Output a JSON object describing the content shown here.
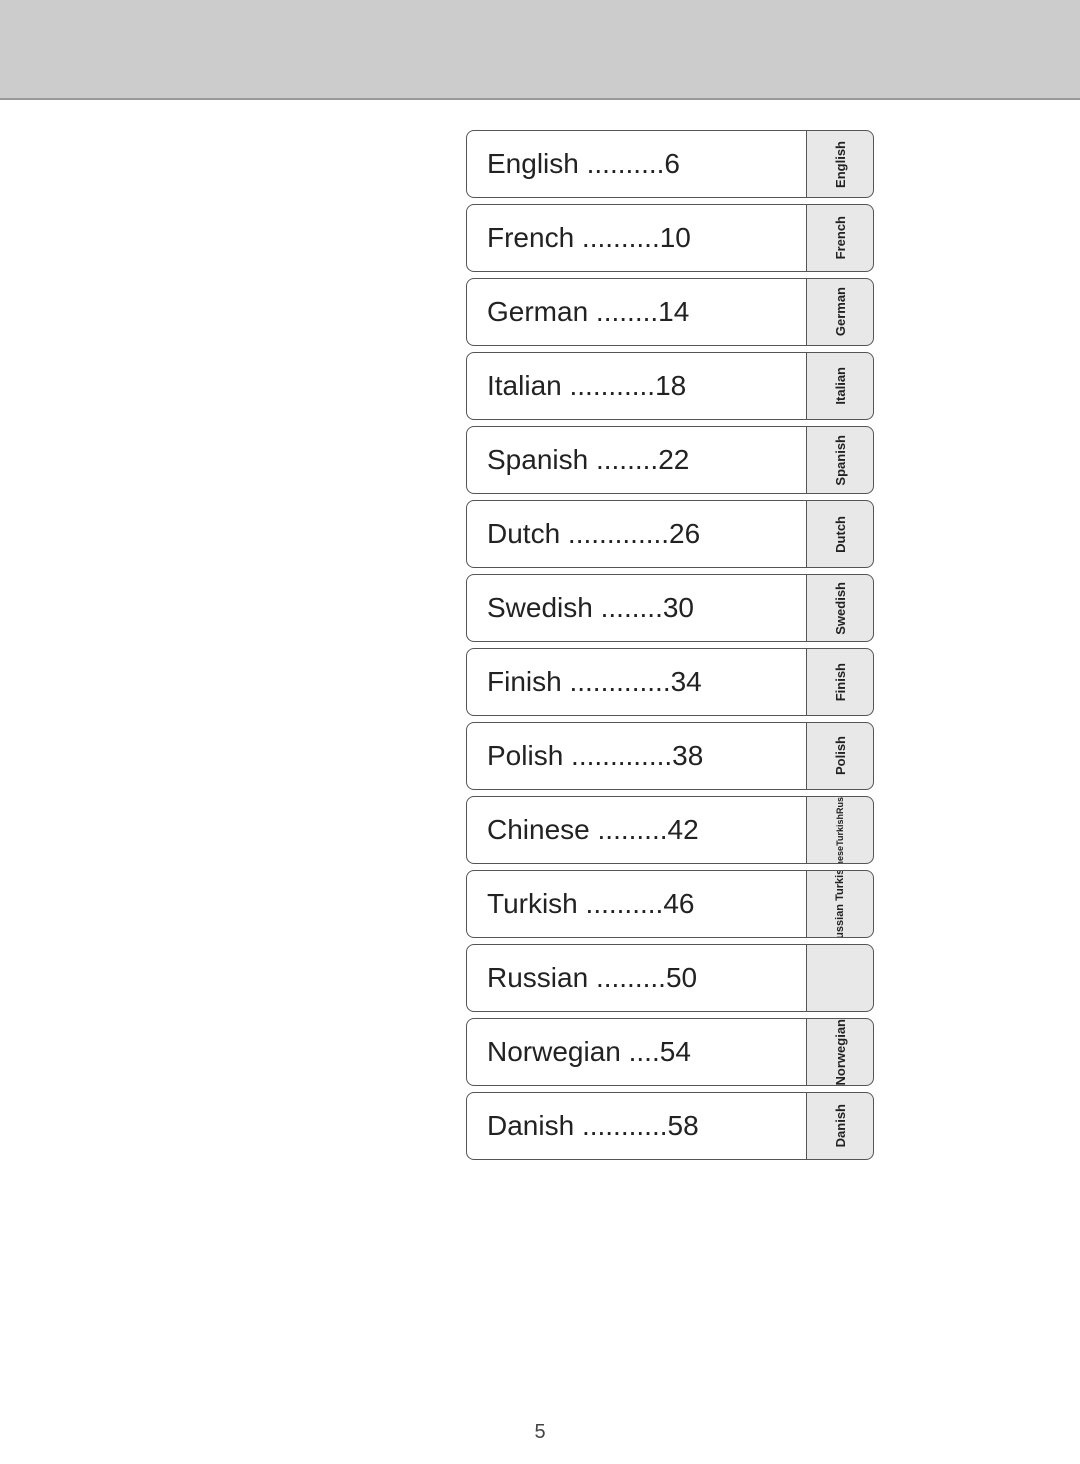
{
  "header": {
    "background": "#cccccc"
  },
  "page_number": "5",
  "toc": {
    "items": [
      {
        "label": "English ..........6",
        "tab": "English",
        "multi": false
      },
      {
        "label": "French ..........10",
        "tab": "French",
        "multi": false
      },
      {
        "label": "German ........14",
        "tab": "German",
        "multi": false
      },
      {
        "label": "Italian ...........18",
        "tab": "Italian",
        "multi": false
      },
      {
        "label": "Spanish ........22",
        "tab": "Spanish",
        "multi": false
      },
      {
        "label": "Dutch .............26",
        "tab": "Dutch",
        "multi": false
      },
      {
        "label": "Swedish ........30",
        "tab": "Swedish",
        "multi": false
      },
      {
        "label": "Finish .............34",
        "tab": "Finish",
        "multi": false
      },
      {
        "label": "Polish .............38",
        "tab": "Polish",
        "multi": false
      },
      {
        "label": "Chinese .........42",
        "tab": "Chinese",
        "multi": false
      },
      {
        "label": "Turkish ..........46",
        "tab": "TurkishChinese",
        "multi": true,
        "tab_lines": [
          "Russian",
          "Turkish",
          "Chinese"
        ]
      },
      {
        "label": "Russian .........50",
        "tab": "",
        "multi": false,
        "empty_tab": true
      },
      {
        "label": "Norwegian ....54",
        "tab": "Norwegian",
        "multi": false
      },
      {
        "label": "Danish ...........58",
        "tab": "Danish",
        "multi": false
      }
    ]
  }
}
